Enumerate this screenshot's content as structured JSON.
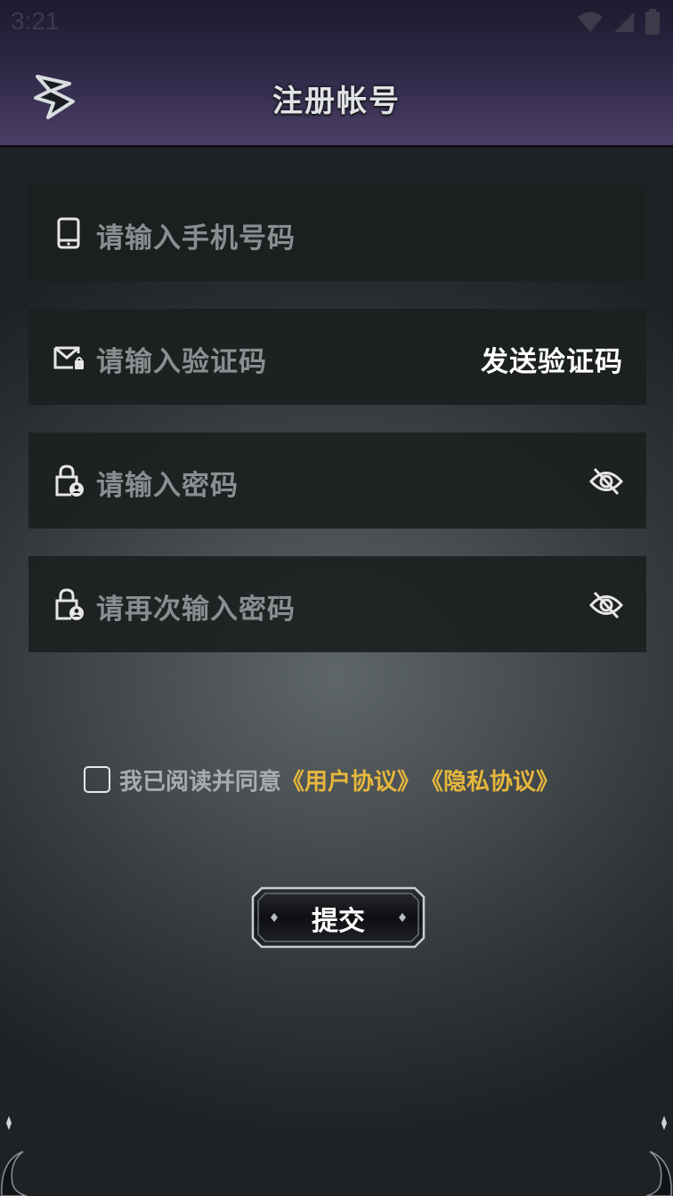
{
  "status_bar": {
    "time": "3:21"
  },
  "header": {
    "title": "注册帐号"
  },
  "form": {
    "phone": {
      "placeholder": "请输入手机号码"
    },
    "code": {
      "placeholder": "请输入验证码",
      "send_label": "发送验证码"
    },
    "password": {
      "placeholder": "请输入密码"
    },
    "password_confirm": {
      "placeholder": "请再次输入密码"
    }
  },
  "agreement": {
    "checked": false,
    "text": "我已阅读并同意",
    "user_agreement": "《用户协议》",
    "privacy_policy": "《隐私协议》"
  },
  "submit": {
    "label": "提交"
  },
  "colors": {
    "accent": "#e7b73c",
    "field_bg": "#1c1f20",
    "placeholder": "#8b8e90"
  }
}
